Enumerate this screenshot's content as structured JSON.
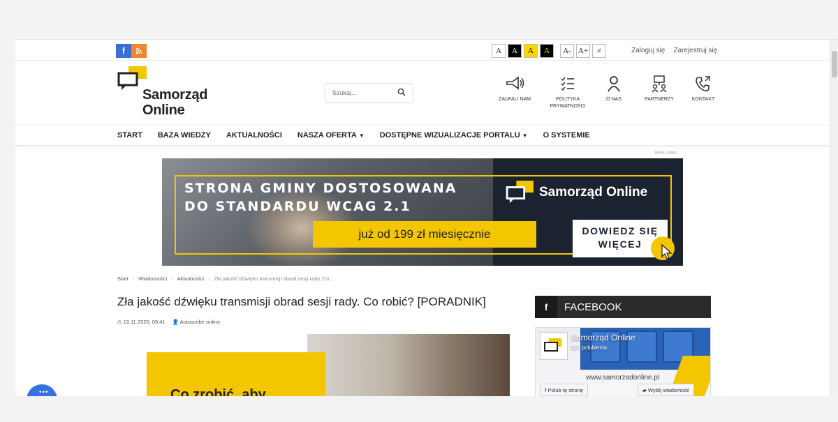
{
  "topbar": {
    "social": [
      {
        "name": "facebook",
        "glyph": "f"
      },
      {
        "name": "rss",
        "glyph": "ʃ"
      }
    ],
    "accessibility": [
      "A",
      "A",
      "A",
      "A",
      "A-",
      "A+",
      "≠"
    ],
    "login": "Zaloguj się",
    "register": "Zarejestruj się"
  },
  "header": {
    "logo_line1": "Samorząd",
    "logo_line2": "Online",
    "search_placeholder": "Szukaj...",
    "nav": [
      {
        "label": "ZAUFALI NAM",
        "icon": "megaphone-icon"
      },
      {
        "label": "POLITYKA PRYWATNOŚCI",
        "icon": "checklist-icon"
      },
      {
        "label": "O NAS",
        "icon": "user-icon"
      },
      {
        "label": "PARTNERZY",
        "icon": "partners-icon"
      },
      {
        "label": "KONTAKT",
        "icon": "phone-icon"
      }
    ]
  },
  "mainnav": [
    "START",
    "BAZA WIEDZY",
    "AKTUALNOŚCI",
    "NASZA OFERTA",
    "DOSTĘPNE WIZUALIZACJE PORTALU",
    "O SYSTEMIE"
  ],
  "banner": {
    "label": "REKLAMA",
    "headline_1": "STRONA GMINY DOSTOSOWANA",
    "headline_2": "DO STANDARDU WCAG 2.1",
    "price": "już od 199 zł miesięcznie",
    "brand": "Samorząd Online",
    "cta_1": "DOWIEDZ SIĘ",
    "cta_2": "WIĘCEJ"
  },
  "breadcrumb": [
    "Start",
    "Wiadomości",
    "Aktualności",
    "Zła jakość dźwięku transmisji obrad sesji rady. Co..."
  ],
  "article": {
    "title": "Zła jakość dźwięku transmisji obrad sesji rady. Co robić? [PORADNIK]",
    "date": "19.11.2020, 09:41",
    "author": "Autoscribe online",
    "image_text": "Co zrobić, aby"
  },
  "sidebar": {
    "facebook_title": "FACEBOOK",
    "page_name": "Samorząd Online",
    "likes": "327 polubienia",
    "url": "www.samorzadonline.pl",
    "like_button": "Polub tę stronę",
    "message_button": "Wyślij wiadomość"
  },
  "colors": {
    "accent": "#f3c600",
    "dark": "#1b2330",
    "facebook": "#3b6fd4"
  }
}
